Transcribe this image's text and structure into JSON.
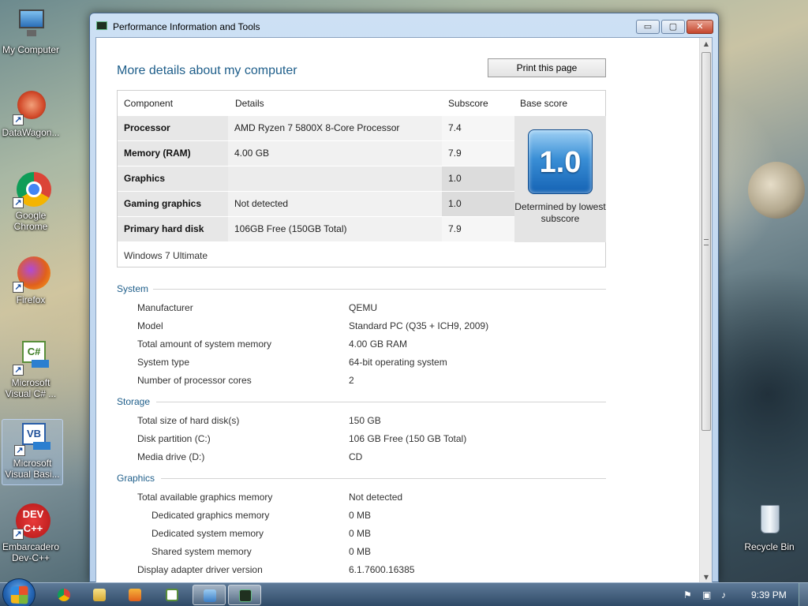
{
  "desktop": {
    "icons": [
      {
        "label": "My Computer",
        "icon": "computer-icon"
      },
      {
        "label": "DataWagon...",
        "icon": "datawagon-icon"
      },
      {
        "label": "Google Chrome",
        "icon": "chrome-icon"
      },
      {
        "label": "Firefox",
        "icon": "firefox-icon"
      },
      {
        "label": "Microsoft Visual C# ...",
        "icon": "visual-csharp-icon"
      },
      {
        "label": "Microsoft Visual Basi...",
        "icon": "visual-basic-icon"
      },
      {
        "label": "Embarcadero Dev-C++",
        "icon": "devcpp-icon"
      },
      {
        "label": "Recycle Bin",
        "icon": "recycle-bin-icon"
      }
    ],
    "csharp_glyph": "C#",
    "vb_glyph": "VB",
    "dev_glyph": "DEV",
    "devpp_glyph": "C++"
  },
  "window": {
    "title": "Performance Information and Tools",
    "heading": "More details about my computer",
    "print_label": "Print this page",
    "controls": {
      "minimize": "▭",
      "maximize": "▢",
      "close": "✕"
    }
  },
  "score_table": {
    "headers": {
      "component": "Component",
      "details": "Details",
      "subscore": "Subscore",
      "base": "Base score"
    },
    "rows": [
      {
        "component": "Processor",
        "details": "AMD Ryzen 7 5800X 8-Core Processor",
        "subscore": "7.4"
      },
      {
        "component": "Memory (RAM)",
        "details": "4.00 GB",
        "subscore": "7.9"
      },
      {
        "component": "Graphics",
        "details": "",
        "subscore": "1.0"
      },
      {
        "component": "Gaming graphics",
        "details": "Not detected",
        "subscore": "1.0"
      },
      {
        "component": "Primary hard disk",
        "details": "106GB Free (150GB Total)",
        "subscore": "7.9"
      }
    ],
    "base_score": "1.0",
    "base_caption": "Determined by lowest subscore",
    "os": "Windows 7 Ultimate"
  },
  "system": {
    "title": "System",
    "items": [
      {
        "label": "Manufacturer",
        "value": "QEMU"
      },
      {
        "label": "Model",
        "value": "Standard PC (Q35 + ICH9, 2009)"
      },
      {
        "label": "Total amount of system memory",
        "value": "4.00 GB RAM"
      },
      {
        "label": "System type",
        "value": "64-bit operating system"
      },
      {
        "label": "Number of processor cores",
        "value": "2"
      }
    ]
  },
  "storage": {
    "title": "Storage",
    "items": [
      {
        "label": "Total size of hard disk(s)",
        "value": "150 GB"
      },
      {
        "label": "Disk partition (C:)",
        "value": "106 GB Free (150 GB Total)"
      },
      {
        "label": "Media drive (D:)",
        "value": "CD"
      }
    ]
  },
  "graphics": {
    "title": "Graphics",
    "items": [
      {
        "label": "Total available graphics memory",
        "value": "Not detected"
      },
      {
        "label": "Dedicated graphics memory",
        "value": "0 MB"
      },
      {
        "label": "Dedicated system memory",
        "value": "0 MB"
      },
      {
        "label": "Shared system memory",
        "value": "0 MB"
      },
      {
        "label": "Display adapter driver version",
        "value": "6.1.7600.16385"
      }
    ]
  },
  "taskbar": {
    "clock": "9:39 PM",
    "buttons": [
      "chrome-icon",
      "explorer-icon",
      "media-player-icon",
      "visual-csharp-icon",
      "remote-desktop-icon",
      "performance-tools-icon"
    ]
  },
  "colors": {
    "accent": "#1e5e8a",
    "row_bg": "#ececec",
    "base_bg": "#e4e4e4"
  }
}
